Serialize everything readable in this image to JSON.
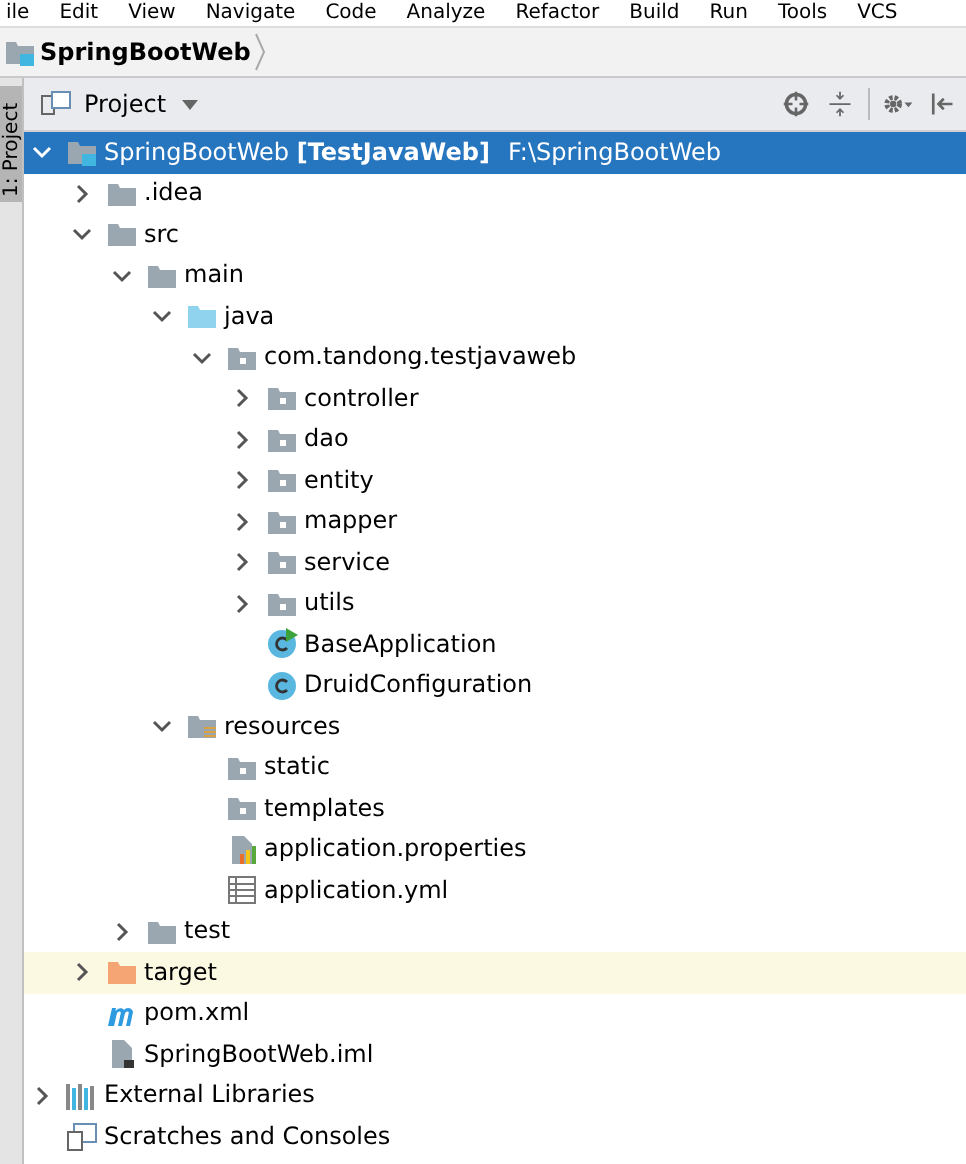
{
  "menu_bar": [
    "ile",
    "Edit",
    "View",
    "Navigate",
    "Code",
    "Analyze",
    "Refactor",
    "Build",
    "Run",
    "Tools",
    "VCS"
  ],
  "breadcrumb": {
    "label": "SpringBootWeb"
  },
  "side_tab": {
    "label": "1: Project"
  },
  "tool_window": {
    "title": "Project"
  },
  "tree": [
    {
      "kind": "module",
      "label": "SpringBootWeb **[TestJavaWeb]**",
      "path": "F:\\SpringBootWeb",
      "expanded": true,
      "selected": true,
      "children": [
        {
          "kind": "folder",
          "label": ".idea",
          "expanded": false,
          "selected": false
        },
        {
          "kind": "folder",
          "label": "src",
          "expanded": true,
          "selected": false,
          "children": [
            {
              "kind": "folder",
              "label": "main",
              "expanded": true,
              "selected": false,
              "children": [
                {
                  "kind": "source",
                  "label": "java",
                  "expanded": true,
                  "selected": false,
                  "children": [
                    {
                      "kind": "package",
                      "label": "com.tandong.testjavaweb",
                      "expanded": true,
                      "selected": false,
                      "children": [
                        {
                          "kind": "package",
                          "label": "controller",
                          "expanded": false,
                          "selected": false
                        },
                        {
                          "kind": "package",
                          "label": "dao",
                          "expanded": false,
                          "selected": false
                        },
                        {
                          "kind": "package",
                          "label": "entity",
                          "expanded": false,
                          "selected": false
                        },
                        {
                          "kind": "package",
                          "label": "mapper",
                          "expanded": false,
                          "selected": false
                        },
                        {
                          "kind": "package",
                          "label": "service",
                          "expanded": false,
                          "selected": false
                        },
                        {
                          "kind": "package",
                          "label": "utils",
                          "expanded": false,
                          "selected": false
                        },
                        {
                          "kind": "runclass",
                          "label": "BaseApplication",
                          "selected": false
                        },
                        {
                          "kind": "class",
                          "label": "DruidConfiguration",
                          "selected": false
                        }
                      ]
                    }
                  ]
                },
                {
                  "kind": "resources",
                  "label": "resources",
                  "expanded": true,
                  "selected": false,
                  "children": [
                    {
                      "kind": "package",
                      "label": "static",
                      "selected": false
                    },
                    {
                      "kind": "package",
                      "label": "templates",
                      "selected": false
                    },
                    {
                      "kind": "properties",
                      "label": "application.properties",
                      "selected": false
                    },
                    {
                      "kind": "yml",
                      "label": "application.yml",
                      "selected": false
                    }
                  ]
                }
              ]
            },
            {
              "kind": "folder",
              "label": "test",
              "expanded": false,
              "selected": false
            }
          ]
        },
        {
          "kind": "excluded",
          "label": "target",
          "expanded": false,
          "selected": false,
          "highlighted": true
        },
        {
          "kind": "maven",
          "label": "pom.xml",
          "selected": false
        },
        {
          "kind": "iml",
          "label": "SpringBootWeb.iml",
          "selected": false
        }
      ]
    },
    {
      "kind": "libraries",
      "label": "External Libraries",
      "expanded": false,
      "selected": false
    },
    {
      "kind": "scratches",
      "label": "Scratches and Consoles",
      "selected": false
    }
  ]
}
